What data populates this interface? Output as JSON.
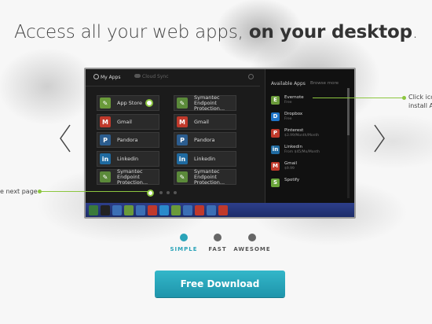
{
  "headline": {
    "light": "Access all your web apps, ",
    "bold": "on your desktop",
    "end": "."
  },
  "screen": {
    "tabs": {
      "my_apps": "My Apps",
      "cloud_sync": "Cloud Sync"
    },
    "tiles_left": [
      "App Store",
      "Gmail",
      "Pandora",
      "Linkedin",
      "Symantec Endpoint\nProtection..."
    ],
    "tiles_right": [
      "Symantec Endpoint\nProtection...",
      "Gmail",
      "Pandora",
      "Linkedin",
      "Symantec Endpoint\nProtection..."
    ],
    "available_title": "Available Apps",
    "browse_more": "Browse more",
    "available": [
      {
        "name": "Evernote",
        "price": "Free",
        "color": "#6a9a3a",
        "glyph": "E"
      },
      {
        "name": "Dropbox",
        "price": "Free",
        "color": "#1e74c8",
        "glyph": "D"
      },
      {
        "name": "Pinterest",
        "price": "$3.99/Month/Month",
        "color": "#c0392b",
        "glyph": "P"
      },
      {
        "name": "Linkedin",
        "price": "From $45/Mo/Month",
        "color": "#1f6aa0",
        "glyph": "in"
      },
      {
        "name": "Gmail",
        "price": "$9.99",
        "color": "#c0392b",
        "glyph": "M"
      },
      {
        "name": "Spotify",
        "price": "",
        "color": "#6aa53a",
        "glyph": "S"
      }
    ]
  },
  "callouts": {
    "left": "e next page",
    "right_line1": "Click ico",
    "right_line2": "install A"
  },
  "steps": [
    "SIMPLE",
    "FAST",
    "AWESOME"
  ],
  "active_step": "SIMPLE",
  "download_label": "Free Download",
  "colors": {
    "accent": "#2aa3b8",
    "callout": "#8cc63f"
  }
}
